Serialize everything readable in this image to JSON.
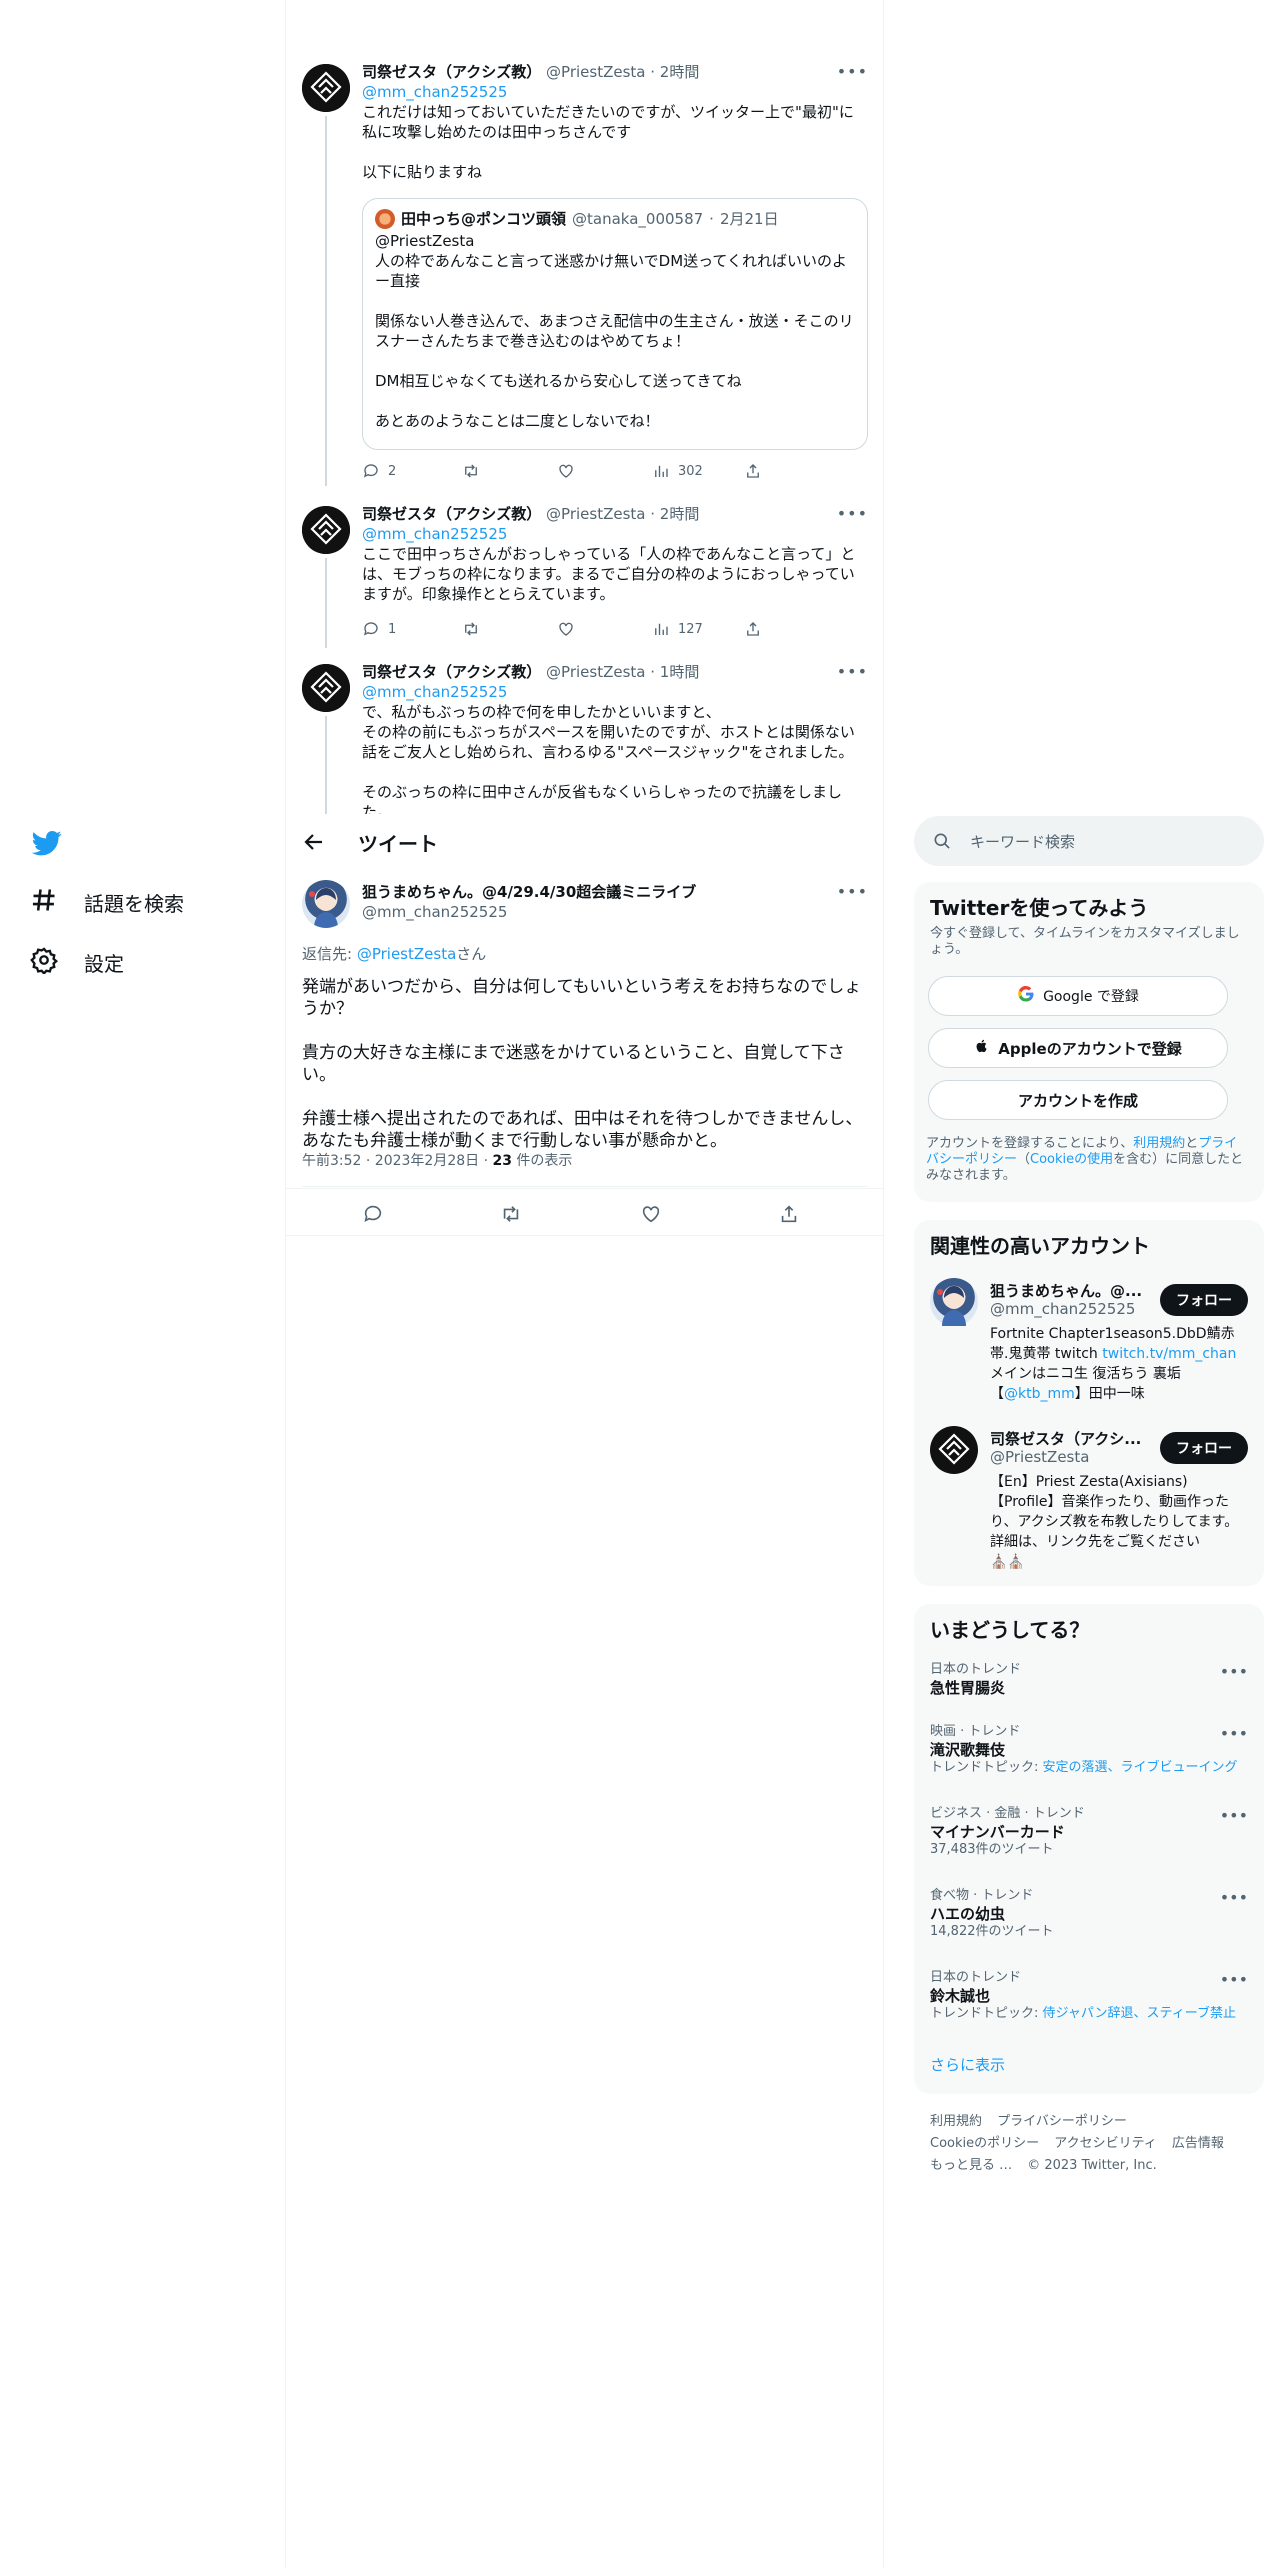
{
  "nav": {
    "explore_label": "話題を検索",
    "settings_label": "設定"
  },
  "thread": [
    {
      "author": "司祭ゼスタ（アクシズ教）",
      "handle": "@PriestZesta",
      "time": "2時間",
      "reply_to": "@mm_chan252525",
      "text": "これだけは知っておいていただきたいのですが、ツイッター上で\"最初\"に私に攻撃し始めたのは田中っちさんです\n\n以下に貼りますね",
      "quote": {
        "author": "田中っち@ポンコツ頭領",
        "handle": "@tanaka_000587",
        "date": "2月21日",
        "text": "@PriestZesta\n人の枠であんなこと言って迷惑かけ無いでDM送ってくれればいいのよー直接\n\n関係ない人巻き込んで、あまつさえ配信中の生主さん・放送・そこのリスナーさんたちまで巻き込むのはやめてちょ！\n\nDM相互じゃなくても送れるから安心して送ってきてね\n\nあとあのようなことは二度としないでね！"
      },
      "replies": "2",
      "views": "302"
    },
    {
      "author": "司祭ゼスタ（アクシズ教）",
      "handle": "@PriestZesta",
      "time": "2時間",
      "reply_to": "@mm_chan252525",
      "text": "ここで田中っちさんがおっしゃっている「人の枠であんなこと言って」とは、モブっちの枠になります。まるでご自分の枠のようにおっしゃっていますが。印象操作ととらえています。",
      "replies": "1",
      "views": "127"
    },
    {
      "author": "司祭ゼスタ（アクシズ教）",
      "handle": "@PriestZesta",
      "time": "1時間",
      "reply_to": "@mm_chan252525",
      "text": "で、私がもぶっちの枠で何を申したかといいますと、\nその枠の前にもぶっちがスペースを開いたのですが、ホストとは関係ない話をご友人とし始められ、言わるゆる\"スペースジャック\"をされました。\n\nそのぶっちの枠に田中さんが反省もなくいらしゃったので抗議をしました。"
    }
  ],
  "header": {
    "title": "ツイート"
  },
  "focus_tweet": {
    "author": "狙うまめちゃん。@4/29.4/30超会議ミニライブ",
    "handle": "@mm_chan252525",
    "reply_prefix": "返信先: ",
    "reply_to": "@PriestZesta",
    "reply_suffix": "さん",
    "text": "発端があいつだから、自分は何してもいいという考えをお持ちなのでしょうか？\n\n貴方の大好きな主様にまで迷惑をかけているということ、自覚して下さい。\n\n弁護士様へ提出されたのであれば、田中はそれを待つしかできませんし、あなたも弁護士様が動くまで行動しない事が懸命かと。",
    "timestamp": "午前3:52 · 2023年2月28日 · ",
    "views_count": "23",
    "views_label": " 件の表示"
  },
  "search": {
    "placeholder": "キーワード検索"
  },
  "signup": {
    "title": "Twitterを使ってみよう",
    "desc": "今すぐ登録して、タイムラインをカスタマイズしましょう。",
    "google": "Google で登録",
    "apple": "Appleのアカウントで登録",
    "create": "アカウントを作成",
    "terms_1": "アカウントを登録することにより、",
    "terms_link1": "利用規約",
    "terms_2": "と",
    "terms_link2": "プライバシーポリシー",
    "terms_3": "（",
    "terms_link3": "Cookieの使用",
    "terms_4": "を含む）に同意したとみなされます。"
  },
  "relevant": {
    "title": "関連性の高いアカウント",
    "follow_label": "フォロー",
    "accounts": [
      {
        "name": "狙うまめちゃん。@...",
        "handle": "@mm_chan252525",
        "bio_1": "Fortnite Chapter1season5.DbD鯖赤帯.鬼黄帯 twitch ",
        "bio_link": "twitch.tv/mm_chan",
        "bio_2": " メインはニコ生 復活ちう 裏垢【",
        "bio_link2": "@ktb_mm",
        "bio_3": "】田中一味"
      },
      {
        "name": "司祭ゼスタ（アクシ...",
        "handle": "@PriestZesta",
        "bio_1": "【En】Priest Zesta(Axisians)\n【Profile】音楽作ったり、動画作ったり、アクシズ教を布教したりしてます。詳細は、リンク先をご覧ください",
        "bio_emoji": "⛪⛪"
      }
    ]
  },
  "trends": {
    "title": "いまどうしてる？",
    "items": [
      {
        "cat": "日本のトレンド",
        "name": "急性胃腸炎",
        "sub": ""
      },
      {
        "cat": "映画 · トレンド",
        "name": "滝沢歌舞伎",
        "sub_prefix": "トレンドトピック: ",
        "sub_link": "安定の落選、ライブビューイング"
      },
      {
        "cat": "ビジネス · 金融 · トレンド",
        "name": "マイナンバーカード",
        "sub": "37,483件のツイート"
      },
      {
        "cat": "食べ物 · トレンド",
        "name": "ハエの幼虫",
        "sub": "14,822件のツイート"
      },
      {
        "cat": "日本のトレンド",
        "name": "鈴木誠也",
        "sub_prefix": "トレンドトピック: ",
        "sub_link": "侍ジャパン辞退、スティーブ禁止"
      }
    ],
    "show_more": "さらに表示"
  },
  "footer": {
    "terms": "利用規約",
    "privacy": "プライバシーポリシー",
    "cookie": "Cookieのポリシー",
    "accessibility": "アクセシビリティ",
    "ads": "広告情報",
    "more": "もっと見る …",
    "copyright": "© 2023 Twitter, Inc."
  },
  "colors": {
    "accent": "#1d9bf0",
    "text": "#0f1419",
    "muted": "#536471",
    "border": "#eff3f4"
  }
}
